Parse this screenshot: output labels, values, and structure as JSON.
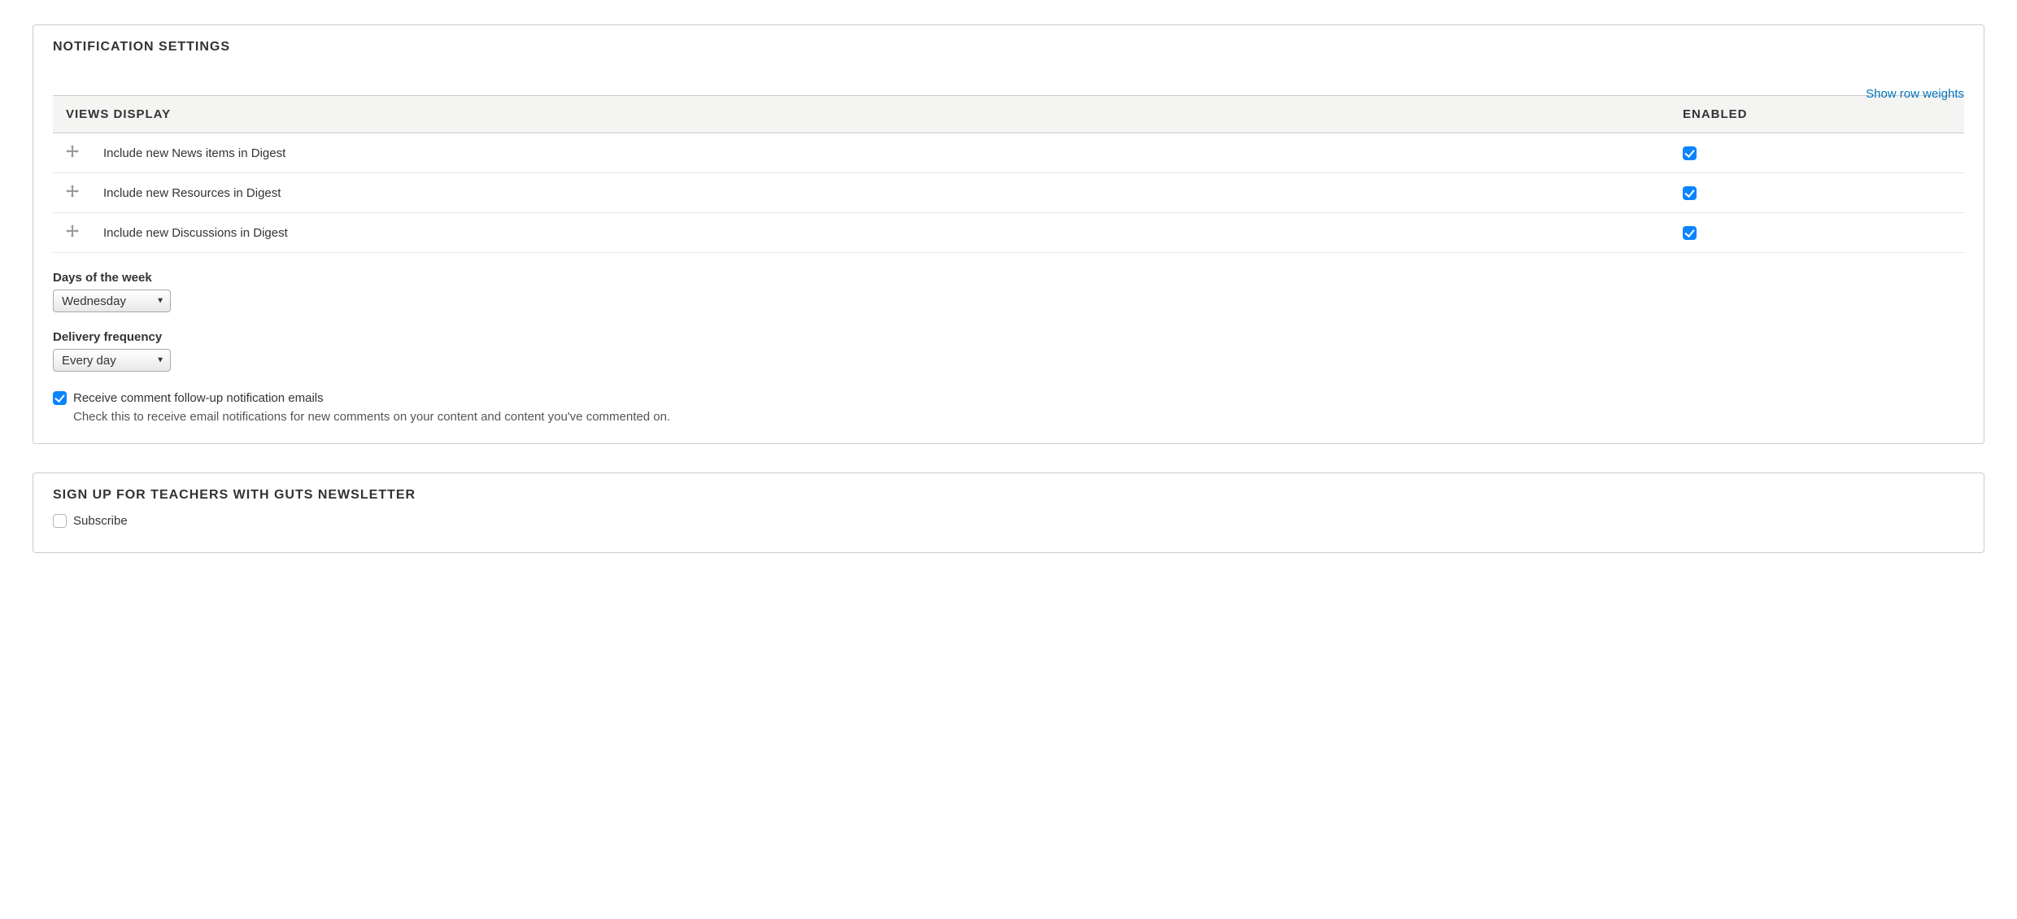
{
  "notification": {
    "title": "NOTIFICATION SETTINGS",
    "show_row_weights": "Show row weights",
    "table": {
      "headers": {
        "views": "VIEWS DISPLAY",
        "enabled": "ENABLED"
      },
      "rows": [
        {
          "label": "Include new News items in Digest",
          "enabled": true
        },
        {
          "label": "Include new Resources in Digest",
          "enabled": true
        },
        {
          "label": "Include new Discussions in Digest",
          "enabled": true
        }
      ]
    },
    "days_label": "Days of the week",
    "days_value": "Wednesday",
    "frequency_label": "Delivery frequency",
    "frequency_value": "Every day",
    "followup_checked": true,
    "followup_label": "Receive comment follow-up notification emails",
    "followup_description": "Check this to receive email notifications for new comments on your content and content you've commented on."
  },
  "newsletter": {
    "title": "SIGN UP FOR TEACHERS WITH GUTS NEWSLETTER",
    "subscribe_checked": false,
    "subscribe_label": "Subscribe"
  }
}
